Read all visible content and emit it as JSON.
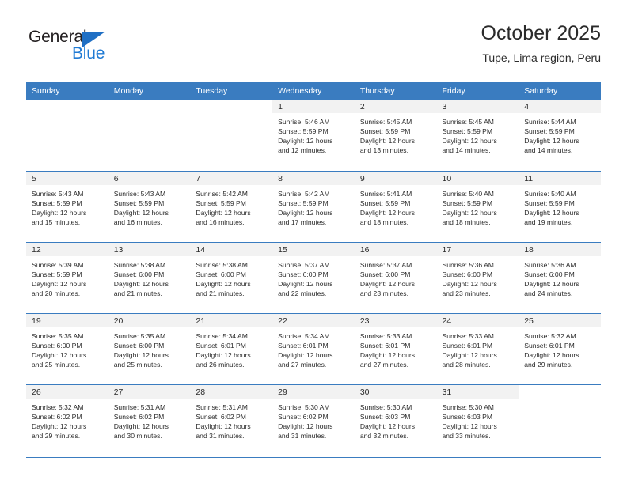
{
  "brand": {
    "name_part1": "General",
    "name_part2": "Blue",
    "triangle_icon": "triangle-icon",
    "colors": {
      "dark": "#231f20",
      "blue": "#1f7ad4",
      "accent": "#3a7cc0"
    }
  },
  "header": {
    "title": "October 2025",
    "subtitle": "Tupe, Lima region, Peru"
  },
  "weekday_headers": [
    "Sunday",
    "Monday",
    "Tuesday",
    "Wednesday",
    "Thursday",
    "Friday",
    "Saturday"
  ],
  "weeks": [
    [
      {
        "day": "",
        "blank": true,
        "sunrise": "",
        "sunset": "",
        "daylight1": "",
        "daylight2": ""
      },
      {
        "day": "",
        "blank": true,
        "sunrise": "",
        "sunset": "",
        "daylight1": "",
        "daylight2": ""
      },
      {
        "day": "",
        "blank": true,
        "sunrise": "",
        "sunset": "",
        "daylight1": "",
        "daylight2": ""
      },
      {
        "day": "1",
        "sunrise": "Sunrise: 5:46 AM",
        "sunset": "Sunset: 5:59 PM",
        "daylight1": "Daylight: 12 hours",
        "daylight2": "and 12 minutes."
      },
      {
        "day": "2",
        "sunrise": "Sunrise: 5:45 AM",
        "sunset": "Sunset: 5:59 PM",
        "daylight1": "Daylight: 12 hours",
        "daylight2": "and 13 minutes."
      },
      {
        "day": "3",
        "sunrise": "Sunrise: 5:45 AM",
        "sunset": "Sunset: 5:59 PM",
        "daylight1": "Daylight: 12 hours",
        "daylight2": "and 14 minutes."
      },
      {
        "day": "4",
        "sunrise": "Sunrise: 5:44 AM",
        "sunset": "Sunset: 5:59 PM",
        "daylight1": "Daylight: 12 hours",
        "daylight2": "and 14 minutes."
      }
    ],
    [
      {
        "day": "5",
        "sunrise": "Sunrise: 5:43 AM",
        "sunset": "Sunset: 5:59 PM",
        "daylight1": "Daylight: 12 hours",
        "daylight2": "and 15 minutes."
      },
      {
        "day": "6",
        "sunrise": "Sunrise: 5:43 AM",
        "sunset": "Sunset: 5:59 PM",
        "daylight1": "Daylight: 12 hours",
        "daylight2": "and 16 minutes."
      },
      {
        "day": "7",
        "sunrise": "Sunrise: 5:42 AM",
        "sunset": "Sunset: 5:59 PM",
        "daylight1": "Daylight: 12 hours",
        "daylight2": "and 16 minutes."
      },
      {
        "day": "8",
        "sunrise": "Sunrise: 5:42 AM",
        "sunset": "Sunset: 5:59 PM",
        "daylight1": "Daylight: 12 hours",
        "daylight2": "and 17 minutes."
      },
      {
        "day": "9",
        "sunrise": "Sunrise: 5:41 AM",
        "sunset": "Sunset: 5:59 PM",
        "daylight1": "Daylight: 12 hours",
        "daylight2": "and 18 minutes."
      },
      {
        "day": "10",
        "sunrise": "Sunrise: 5:40 AM",
        "sunset": "Sunset: 5:59 PM",
        "daylight1": "Daylight: 12 hours",
        "daylight2": "and 18 minutes."
      },
      {
        "day": "11",
        "sunrise": "Sunrise: 5:40 AM",
        "sunset": "Sunset: 5:59 PM",
        "daylight1": "Daylight: 12 hours",
        "daylight2": "and 19 minutes."
      }
    ],
    [
      {
        "day": "12",
        "sunrise": "Sunrise: 5:39 AM",
        "sunset": "Sunset: 5:59 PM",
        "daylight1": "Daylight: 12 hours",
        "daylight2": "and 20 minutes."
      },
      {
        "day": "13",
        "sunrise": "Sunrise: 5:38 AM",
        "sunset": "Sunset: 6:00 PM",
        "daylight1": "Daylight: 12 hours",
        "daylight2": "and 21 minutes."
      },
      {
        "day": "14",
        "sunrise": "Sunrise: 5:38 AM",
        "sunset": "Sunset: 6:00 PM",
        "daylight1": "Daylight: 12 hours",
        "daylight2": "and 21 minutes."
      },
      {
        "day": "15",
        "sunrise": "Sunrise: 5:37 AM",
        "sunset": "Sunset: 6:00 PM",
        "daylight1": "Daylight: 12 hours",
        "daylight2": "and 22 minutes."
      },
      {
        "day": "16",
        "sunrise": "Sunrise: 5:37 AM",
        "sunset": "Sunset: 6:00 PM",
        "daylight1": "Daylight: 12 hours",
        "daylight2": "and 23 minutes."
      },
      {
        "day": "17",
        "sunrise": "Sunrise: 5:36 AM",
        "sunset": "Sunset: 6:00 PM",
        "daylight1": "Daylight: 12 hours",
        "daylight2": "and 23 minutes."
      },
      {
        "day": "18",
        "sunrise": "Sunrise: 5:36 AM",
        "sunset": "Sunset: 6:00 PM",
        "daylight1": "Daylight: 12 hours",
        "daylight2": "and 24 minutes."
      }
    ],
    [
      {
        "day": "19",
        "sunrise": "Sunrise: 5:35 AM",
        "sunset": "Sunset: 6:00 PM",
        "daylight1": "Daylight: 12 hours",
        "daylight2": "and 25 minutes."
      },
      {
        "day": "20",
        "sunrise": "Sunrise: 5:35 AM",
        "sunset": "Sunset: 6:00 PM",
        "daylight1": "Daylight: 12 hours",
        "daylight2": "and 25 minutes."
      },
      {
        "day": "21",
        "sunrise": "Sunrise: 5:34 AM",
        "sunset": "Sunset: 6:01 PM",
        "daylight1": "Daylight: 12 hours",
        "daylight2": "and 26 minutes."
      },
      {
        "day": "22",
        "sunrise": "Sunrise: 5:34 AM",
        "sunset": "Sunset: 6:01 PM",
        "daylight1": "Daylight: 12 hours",
        "daylight2": "and 27 minutes."
      },
      {
        "day": "23",
        "sunrise": "Sunrise: 5:33 AM",
        "sunset": "Sunset: 6:01 PM",
        "daylight1": "Daylight: 12 hours",
        "daylight2": "and 27 minutes."
      },
      {
        "day": "24",
        "sunrise": "Sunrise: 5:33 AM",
        "sunset": "Sunset: 6:01 PM",
        "daylight1": "Daylight: 12 hours",
        "daylight2": "and 28 minutes."
      },
      {
        "day": "25",
        "sunrise": "Sunrise: 5:32 AM",
        "sunset": "Sunset: 6:01 PM",
        "daylight1": "Daylight: 12 hours",
        "daylight2": "and 29 minutes."
      }
    ],
    [
      {
        "day": "26",
        "sunrise": "Sunrise: 5:32 AM",
        "sunset": "Sunset: 6:02 PM",
        "daylight1": "Daylight: 12 hours",
        "daylight2": "and 29 minutes."
      },
      {
        "day": "27",
        "sunrise": "Sunrise: 5:31 AM",
        "sunset": "Sunset: 6:02 PM",
        "daylight1": "Daylight: 12 hours",
        "daylight2": "and 30 minutes."
      },
      {
        "day": "28",
        "sunrise": "Sunrise: 5:31 AM",
        "sunset": "Sunset: 6:02 PM",
        "daylight1": "Daylight: 12 hours",
        "daylight2": "and 31 minutes."
      },
      {
        "day": "29",
        "sunrise": "Sunrise: 5:30 AM",
        "sunset": "Sunset: 6:02 PM",
        "daylight1": "Daylight: 12 hours",
        "daylight2": "and 31 minutes."
      },
      {
        "day": "30",
        "sunrise": "Sunrise: 5:30 AM",
        "sunset": "Sunset: 6:03 PM",
        "daylight1": "Daylight: 12 hours",
        "daylight2": "and 32 minutes."
      },
      {
        "day": "31",
        "sunrise": "Sunrise: 5:30 AM",
        "sunset": "Sunset: 6:03 PM",
        "daylight1": "Daylight: 12 hours",
        "daylight2": "and 33 minutes."
      },
      {
        "day": "",
        "blank": true,
        "sunrise": "",
        "sunset": "",
        "daylight1": "",
        "daylight2": ""
      }
    ]
  ]
}
